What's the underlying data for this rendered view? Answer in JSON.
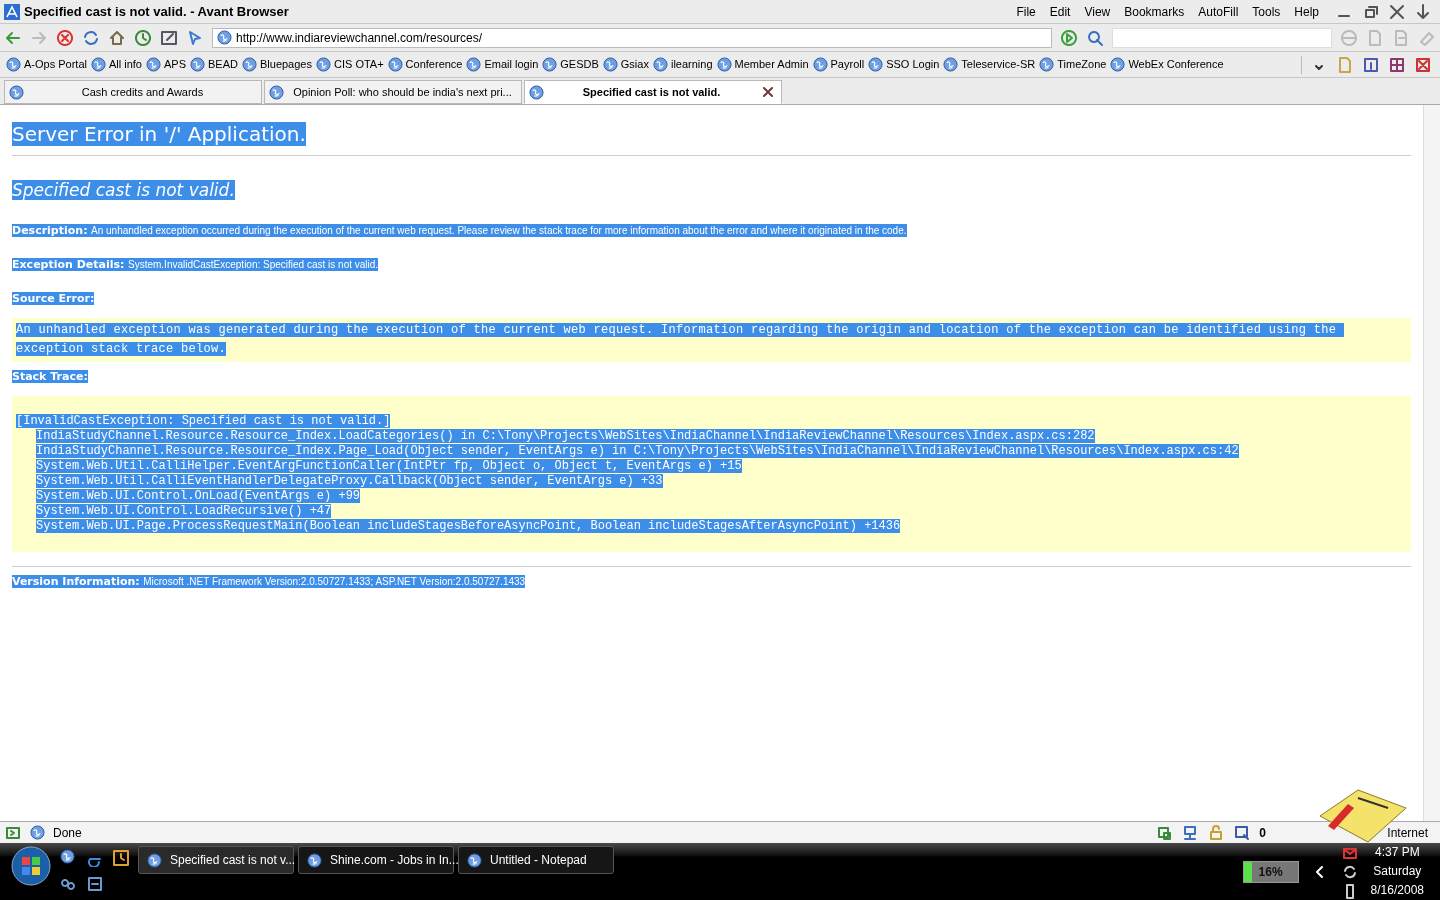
{
  "window": {
    "title": "Specified cast is not valid. - Avant Browser",
    "menu": [
      "File",
      "Edit",
      "View",
      "Bookmarks",
      "AutoFill",
      "Tools",
      "Help"
    ]
  },
  "address": {
    "url": "http://www.indiareviewchannel.com/resources/"
  },
  "bookmarks": [
    "A-Ops Portal",
    "All info",
    "APS",
    "BEAD",
    "Bluepages",
    "CIS OTA+",
    "Conference",
    "Email login",
    "GESDB",
    "Gsiax",
    "ilearning",
    "Member Admin",
    "Payroll",
    "SSO Login",
    "Teleservice-SR",
    "TimeZone",
    "WebEx Conference"
  ],
  "tabs": [
    {
      "label": "Cash credits and Awards",
      "selected": false
    },
    {
      "label": "Opinion Poll: who should be india's next pri...",
      "selected": false
    },
    {
      "label": "Specified cast is not valid.",
      "selected": true
    }
  ],
  "page": {
    "selected": true,
    "title": "Server Error in '/' Application.",
    "subtitle": "Specified cast is not valid.",
    "sections": [
      {
        "kind": "field",
        "label": "Description:",
        "text": "An unhandled exception occurred during the execution of the current web request. Please review the stack trace for more information about the error and where it originated in the code."
      },
      {
        "kind": "field",
        "label": "Exception Details:",
        "text": "System.InvalidCastException: Specified cast is not valid."
      },
      {
        "kind": "heading",
        "label": "Source Error:"
      },
      {
        "kind": "code",
        "lines": [
          {
            "kind": "text",
            "text": "An unhandled exception was generated during the execution of the current web request. Information regarding the origin and location of the exception can be identified using the exception stack trace below."
          }
        ]
      },
      {
        "kind": "heading",
        "label": "Stack Trace:"
      },
      {
        "kind": "code",
        "lines": [
          {
            "kind": "header",
            "text": "[InvalidCastException: Specified cast is not valid.]"
          },
          {
            "kind": "frame",
            "text": "IndiaStudyChannel.Resource.Resource_Index.LoadCategories() in C:\\Tony\\Projects\\WebSites\\IndiaChannel\\IndiaReviewChannel\\Resources\\Index.aspx.cs:282"
          },
          {
            "kind": "frame",
            "text": "IndiaStudyChannel.Resource.Resource_Index.Page_Load(Object sender, EventArgs e) in C:\\Tony\\Projects\\WebSites\\IndiaChannel\\IndiaReviewChannel\\Resources\\Index.aspx.cs:42"
          },
          {
            "kind": "frame",
            "text": "System.Web.Util.CalliHelper.EventArgFunctionCaller(IntPtr fp, Object o, Object t, EventArgs e) +15"
          },
          {
            "kind": "frame",
            "text": "System.Web.Util.CalliEventHandlerDelegateProxy.Callback(Object sender, EventArgs e) +33"
          },
          {
            "kind": "frame",
            "text": "System.Web.UI.Control.OnLoad(EventArgs e) +99"
          },
          {
            "kind": "frame",
            "text": "System.Web.UI.Control.LoadRecursive() +47"
          },
          {
            "kind": "frame",
            "text": "System.Web.UI.Page.ProcessRequestMain(Boolean includeStagesBeforeAsyncPoint, Boolean includeStagesAfterAsyncPoint) +1436"
          }
        ]
      },
      {
        "kind": "rule"
      },
      {
        "kind": "field",
        "label": "Version Information:",
        "text": "Microsoft .NET Framework Version:2.0.50727.1433; ASP.NET Version:2.0.50727.1433"
      }
    ]
  },
  "status": {
    "text": "Done",
    "popups": "0",
    "zone": "Internet"
  },
  "taskbar": {
    "tasks": [
      {
        "label": "Specified cast is not v...",
        "selected": true
      },
      {
        "label": "Shine.com - Jobs in In...",
        "selected": false
      },
      {
        "label": "Untitled - Notepad",
        "selected": false
      }
    ],
    "battery": {
      "label": "16%",
      "level": 0.16
    },
    "time": "4:37 PM",
    "day": "Saturday",
    "date": "8/16/2008"
  }
}
